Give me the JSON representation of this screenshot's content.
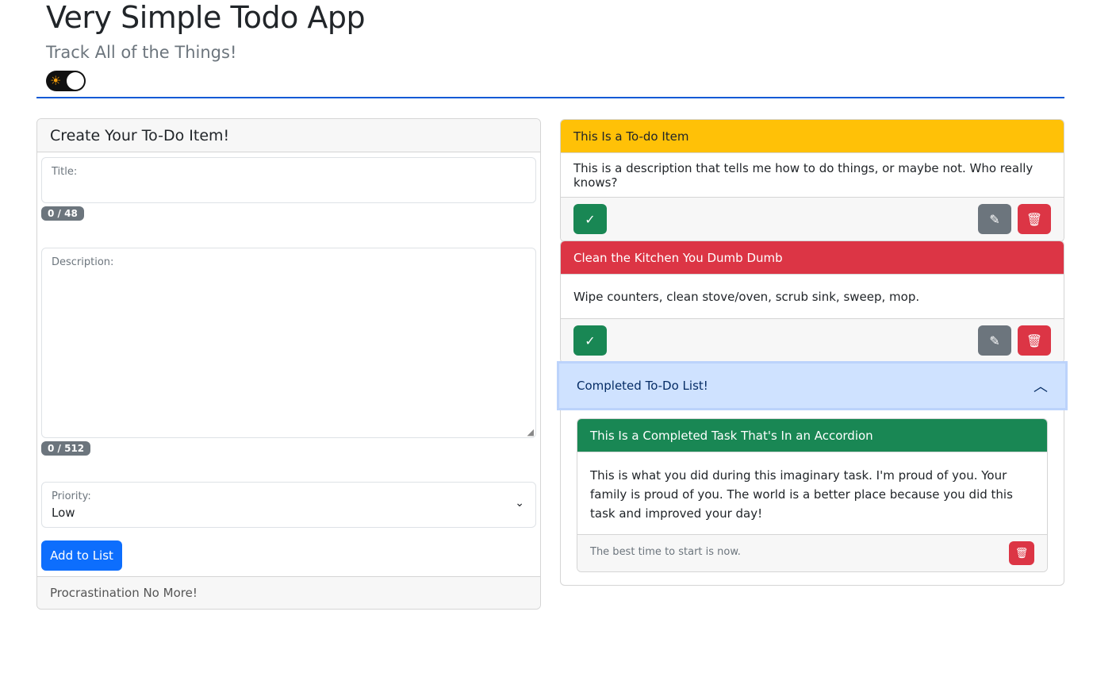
{
  "header": {
    "title": "Very Simple Todo App",
    "subtitle": "Track All of the Things!",
    "theme_toggle_icon": "sun-icon"
  },
  "form": {
    "card_title": "Create Your To-Do Item!",
    "title_label": "Title:",
    "title_value": "",
    "title_count": "0 / 48",
    "description_label": "Description:",
    "description_value": "",
    "description_count": "0 / 512",
    "priority_label": "Priority:",
    "priority_value": "Low",
    "submit_label": "Add to List",
    "footer": "Procrastination No More!"
  },
  "todos": [
    {
      "title": "This Is a To-do Item",
      "description": "This is a description that tells me how to do things, or maybe not. Who really knows?",
      "color": "#ffc107",
      "text_color": "#212529"
    },
    {
      "title": "Clean the Kitchen You Dumb Dumb",
      "description": "Wipe counters, clean stove/oven, scrub sink, sweep, mop.",
      "color": "#dc3545",
      "text_color": "#ffffff"
    }
  ],
  "completed": {
    "accordion_title": "Completed To-Do List!",
    "items": [
      {
        "title": "This Is a Completed Task That's In an Accordion",
        "description": "This is what you did during this imaginary task. I'm proud of you. Your family is proud of you. The world is a better place because you did this task and improved your day!",
        "footer": "The best time to start is now.",
        "color": "#198754"
      }
    ]
  }
}
